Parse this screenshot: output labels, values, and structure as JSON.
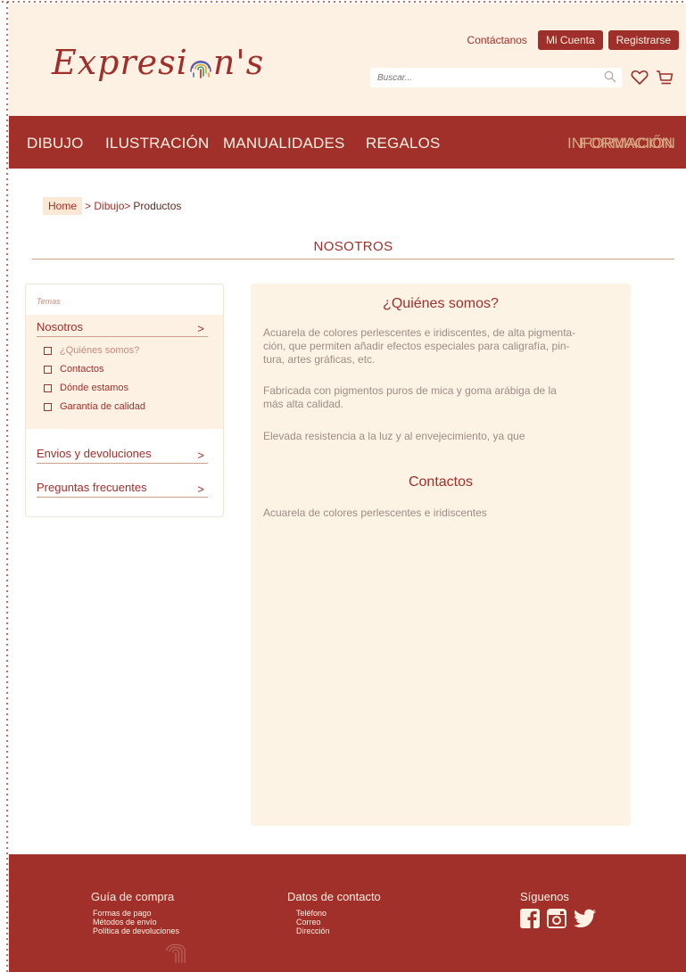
{
  "brand": {
    "logo_text_1": "Expresi",
    "logo_text_2": "n's"
  },
  "header": {
    "contact_link": "Contáctanos",
    "account_button": "Mi Cuenta",
    "register_button": "Registrarse",
    "search_placeholder": "Buscar..."
  },
  "nav": {
    "items": [
      "DIBUJO",
      "ILUSTRACIÓN",
      "MANUALIDADES",
      "REGALOS"
    ],
    "info_a": "INFORMACIÓN",
    "info_b": "FORMACIÓN"
  },
  "breadcrumb": {
    "home": "Home",
    "level1": "> Dibujo>",
    "current": "Productos"
  },
  "page_title": "NOSOTROS",
  "sidebar": {
    "heading": "Temas",
    "sections": [
      {
        "label": "Nosotros",
        "arrow": ">"
      },
      {
        "label": "Envios y devoluciones",
        "arrow": ">"
      },
      {
        "label": "Preguntas frecuentes",
        "arrow": ">"
      }
    ],
    "sub_items": [
      "¿Quiénes somos?",
      "Contactos",
      "Dónde estamos",
      "Garantía de calidad"
    ]
  },
  "content": {
    "heading1": "¿Quiénes somos?",
    "para1_line1": "Acuarela de colores perlescentes e iridiscentes, de alta pigmenta-",
    "para1_line2": "ción, que permiten añadir efectos especiales para caligrafía, pin-",
    "para1_line3": "tura, artes gráficas, etc.",
    "para2_line1": "Fabricada con pigmentos puros de mica y goma arábiga de la",
    "para2_line2": "más alta calidad.",
    "para3": "Elevada resistencia a la luz y al envejecimiento, ya que",
    "heading2": "Contactos",
    "para4": "Acuarela de colores perlescentes e iridiscentes"
  },
  "footer": {
    "guide": {
      "title": "Guía de compra",
      "links": [
        "Formas de pago",
        "Métodos de envío",
        "Política de devoluciones"
      ]
    },
    "contact": {
      "title": "Datos de contacto",
      "links": [
        "Teléfono",
        "Correo",
        "Dirección"
      ]
    },
    "social": {
      "title": "Síguenos",
      "icons": [
        "facebook-icon",
        "instagram-icon",
        "twitter-icon"
      ]
    }
  },
  "colors": {
    "primary": "#a1302b",
    "cream": "#fdf1e3",
    "muted_text": "#9d8c85",
    "accent_orange": "#d9a583"
  }
}
